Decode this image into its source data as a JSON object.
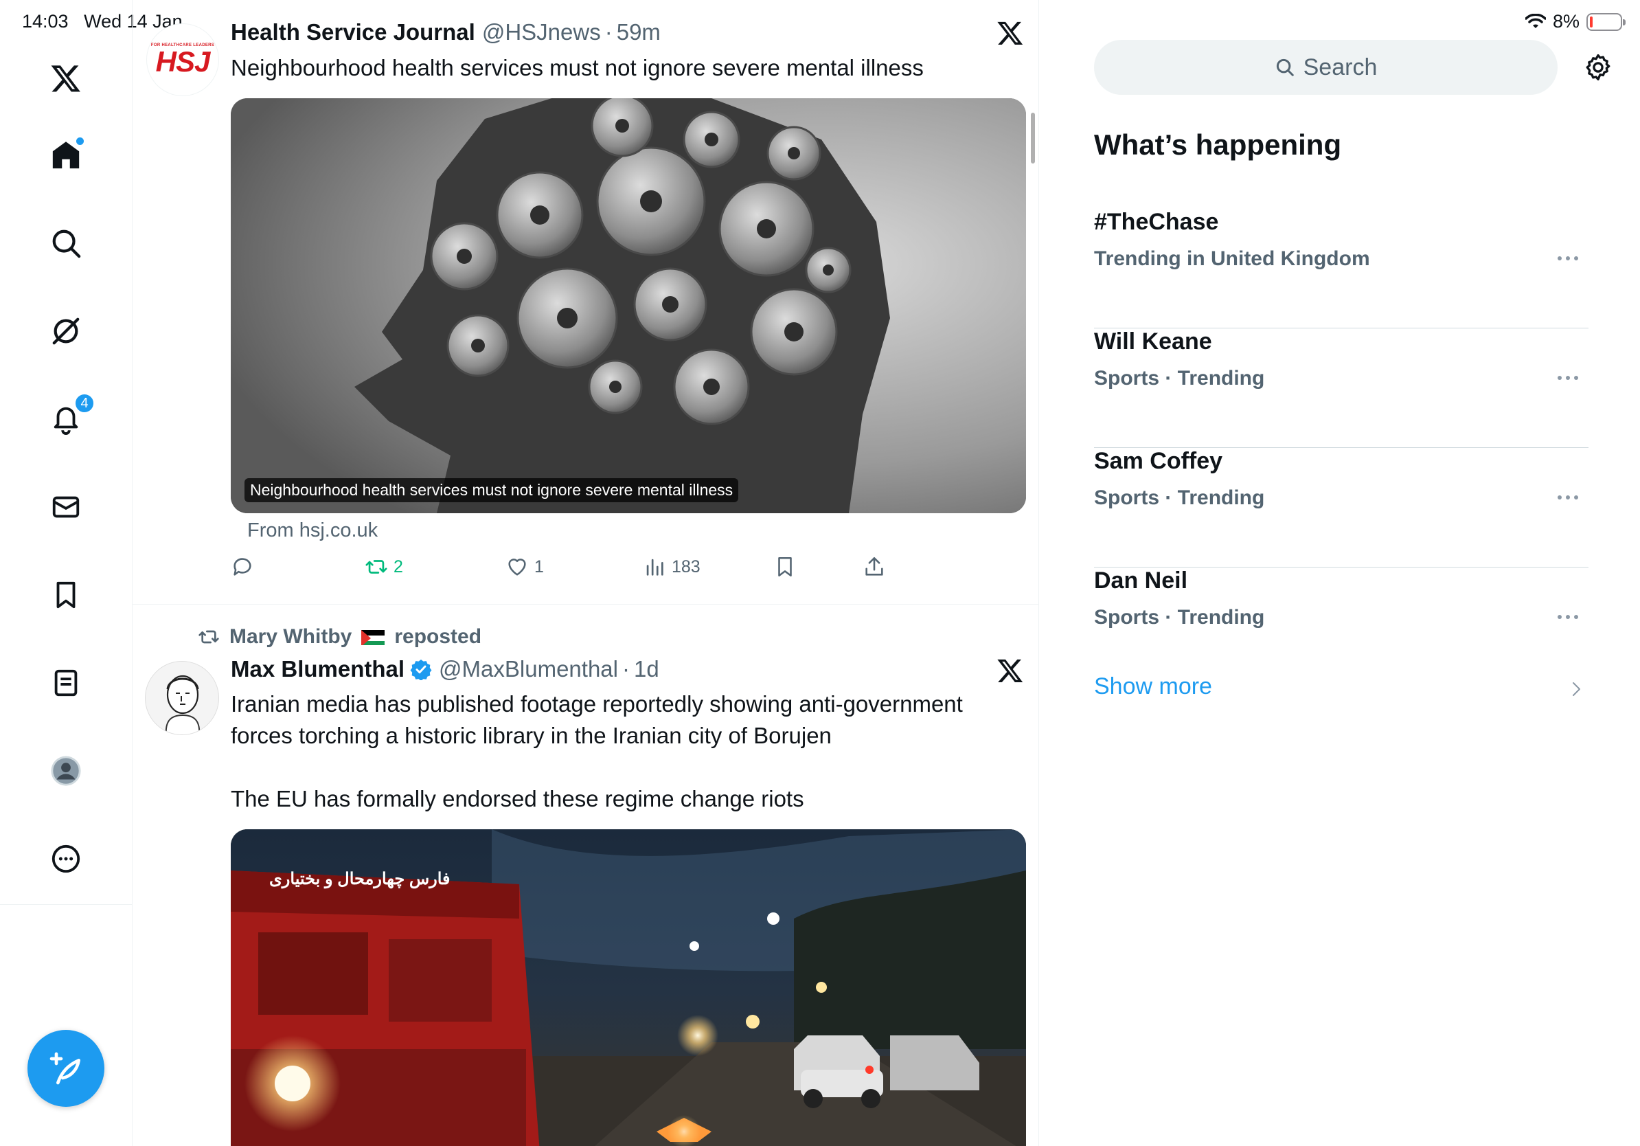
{
  "status_bar": {
    "time_date": "14:03   Wed 14 Jan",
    "battery": "8%",
    "battery_level": 0.08
  },
  "nav": {
    "items": [
      "x-logo",
      "home",
      "explore",
      "grok",
      "notifications",
      "messages",
      "bookmarks",
      "lists",
      "profile",
      "more"
    ],
    "notifications_badge": "4"
  },
  "tweet1": {
    "name": "Health Service Journal",
    "handle": "@HSJnews",
    "separator": "·",
    "time": "59m",
    "text": "Neighbourhood health services must not ignore severe mental illness",
    "avatar_tagline": "FOR HEALTHCARE LEADERS",
    "avatar_logo": "HSJ",
    "card_caption": "Neighbourhood health services must not ignore severe mental illness",
    "card_from": "From hsj.co.uk",
    "actions": {
      "reply": "",
      "retweet": "2",
      "like": "1",
      "views": "183"
    }
  },
  "tweet2": {
    "reposted_by": "Mary Whitby",
    "reposted_label": "reposted",
    "name": "Max Blumenthal",
    "handle": "@MaxBlumenthal",
    "separator": "·",
    "time": "1d",
    "text_line1": "Iranian media has published footage reportedly showing anti-government",
    "text_line2": "forces torching a historic library in the Iranian city of Borujen",
    "text_line3": "The EU has formally endorsed these regime change riots",
    "video_watermark": "فارس چهارمحال و بختیاری"
  },
  "sidebar": {
    "search_placeholder": "Search",
    "title": "What’s happening",
    "trends": [
      {
        "name": "#TheChase",
        "meta": "Trending in United Kingdom"
      },
      {
        "name": "Will Keane",
        "meta": "Sports · Trending"
      },
      {
        "name": "Sam Coffey",
        "meta": "Sports · Trending"
      },
      {
        "name": "Dan Neil",
        "meta": "Sports · Trending"
      }
    ],
    "show_more": "Show more"
  },
  "colors": {
    "accent": "#1d9bf0",
    "retweet": "#00ba7c",
    "text": "#0f1419",
    "secondary": "#536471",
    "hsj_red": "#d71920"
  }
}
